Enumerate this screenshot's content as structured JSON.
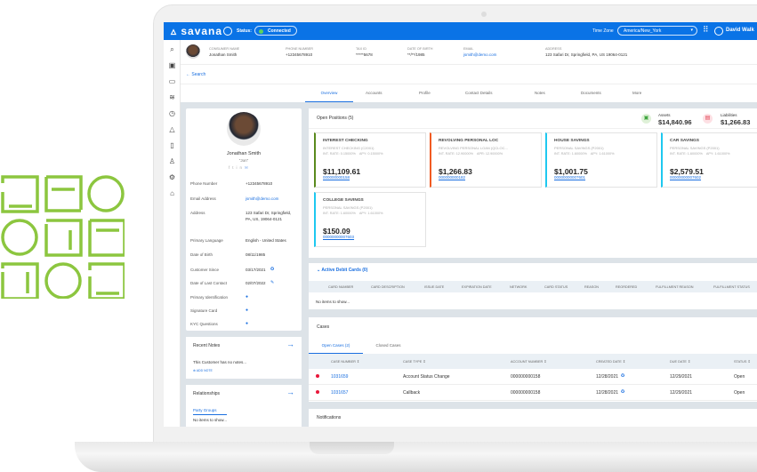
{
  "brand": {
    "name": "savana",
    "accent": "#0a73e6",
    "pattern_color": "#8cc63f"
  },
  "header": {
    "status_label": "Status:",
    "status_value": "Connected",
    "timezone_label": "Time Zone",
    "timezone_value": "America/New_York",
    "user": "David Walk"
  },
  "sidebar": {
    "icons": [
      "search-icon",
      "briefcase-icon",
      "folder-icon",
      "layers-icon",
      "clock-icon",
      "warning-icon",
      "clipboard-icon",
      "user-icon",
      "gear-icon",
      "bank-icon"
    ]
  },
  "customer": {
    "fields": [
      {
        "label": "CONSUMER NAME",
        "value": "Jonathan Smith"
      },
      {
        "label": "PHONE NUMBER",
        "value": "+12345678910"
      },
      {
        "label": "TAX ID",
        "value": "*****5678"
      },
      {
        "label": "DATE OF BIRTH",
        "value": "**/**/1985"
      },
      {
        "label": "EMAIL",
        "value": "jsmith@demo.com"
      },
      {
        "label": "ADDRESS",
        "value": "123 Safari Dr, Springfield, PA, US 19064-0121"
      }
    ]
  },
  "search_link": "Search",
  "tabs": [
    "Overview",
    "Accounts",
    "Profile",
    "Contact Details",
    "Notes",
    "Documents",
    "More"
  ],
  "profile": {
    "name": "Jonathan Smith",
    "nickname": "\"Jon\"",
    "details": [
      {
        "label": "Phone Number",
        "value": "+12345678910"
      },
      {
        "label": "Email Address",
        "value": "jsmith@demo.com"
      },
      {
        "label": "Address",
        "value": "123 Safari Dr, Springfield, PA, US, 19064-0121"
      },
      {
        "label": "Primary Language",
        "value": "English - United States"
      },
      {
        "label": "Date of Birth",
        "value": "08/11/1985"
      },
      {
        "label": "Customer Since",
        "value": "03/17/2021"
      },
      {
        "label": "Date of Last Contact",
        "value": "02/07/2022"
      },
      {
        "label": "Primary Identification",
        "value": ""
      },
      {
        "label": "Signature Card",
        "value": ""
      },
      {
        "label": "KYC Questions",
        "value": ""
      }
    ]
  },
  "recent_notes": {
    "title": "Recent Notes",
    "empty": "This Customer has no notes...",
    "add": "ADD NOTE"
  },
  "relationships": {
    "title": "Relationships",
    "tab": "Party Groups",
    "empty": "No items to show..."
  },
  "positions": {
    "title": "Open Positions (5)",
    "assets_label": "Assets",
    "assets": "$14,840.96",
    "liabilities_label": "Liabilities",
    "liabilities": "$1,266.83",
    "cards": [
      {
        "title": "INTEREST CHECKING",
        "sub": "INTEREST CHECKING (C2001)",
        "rate": "INT. RATE: 0.15000%    APY: 0.15000%",
        "amount": "$11,109.61",
        "number": "000000000158",
        "color": "#5a8a1e"
      },
      {
        "title": "REVOLVING PERSONAL LOC",
        "sub": "REVOLVING PERSONAL LOAN (QCLOC...",
        "rate": "INT. RATE: 12.90000%    APR: 12.90000%",
        "amount": "$1,266.83",
        "number": "000000000182",
        "color": "#f15a22"
      },
      {
        "title": "HOUSE SAVINGS",
        "sub": "PERSONAL SAVINGS (P2001)",
        "rate": "INT. RATE: 1.60000%    APY: 1.61000%",
        "amount": "$1,001.75",
        "number": "00000000007601",
        "color": "#1ec8f0"
      },
      {
        "title": "CAR SAVINGS",
        "sub": "PERSONAL SAVINGS (P2001)",
        "rate": "INT. RATE: 1.60000%    APY: 1.61000%",
        "amount": "$2,579.51",
        "number": "00000000007602",
        "color": "#1ec8f0"
      },
      {
        "title": "COLLEGE SAVINGS",
        "sub": "PERSONAL SAVINGS (P2001)",
        "rate": "INT. RATE: 1.60000%    APY: 1.61000%",
        "amount": "$150.09",
        "number": "00000000007603",
        "color": "#1ec8f0"
      }
    ]
  },
  "debit": {
    "title": "Active Debit Cards (0)",
    "columns": [
      "CARD NUMBER",
      "CARD DESCRIPTION",
      "ISSUE DATE",
      "EXPIRATION DATE",
      "NETWORK",
      "CARD STATUS",
      "REASON",
      "REORDERED",
      "FULFILLMENT REASON",
      "FULFILLMENT STATUS"
    ],
    "empty": "No items to show..."
  },
  "cases": {
    "title": "Cases",
    "tabs": [
      "Open Cases (2)",
      "Closed Cases"
    ],
    "columns": [
      "CASE NUMBER",
      "CASE TYPE",
      "ACCOUNT NUMBER",
      "CREATED DATE",
      "DUE DATE",
      "STATUS"
    ],
    "rows": [
      [
        "1031659",
        "Account Status Change",
        "000000000158",
        "12/28/2021",
        "12/29/2021",
        "Open"
      ],
      [
        "1031657",
        "Callback",
        "000000000158",
        "12/28/2021",
        "12/29/2021",
        "Open"
      ]
    ]
  },
  "notifications": {
    "title": "Notifications"
  }
}
